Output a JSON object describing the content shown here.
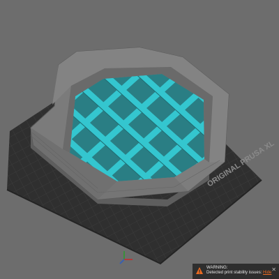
{
  "viewport": {
    "bed_label": "ORIGINAL PRUSA XL",
    "colors": {
      "background": "#6d6d6d",
      "bed": "#2f2f2f",
      "bed_grid": "#3d3d3d",
      "model_wall": "#7a7a7a",
      "model_wall_dark": "#636363",
      "infill": "#34c6cf"
    }
  },
  "notification": {
    "icon": "warning-triangle-icon",
    "title": "WARNING:",
    "message": "Detected print stability issues:",
    "link": "Hide",
    "close_icon": "close-icon",
    "colors": {
      "background": "#2e2e2e",
      "accent": "#ed6b21"
    }
  }
}
